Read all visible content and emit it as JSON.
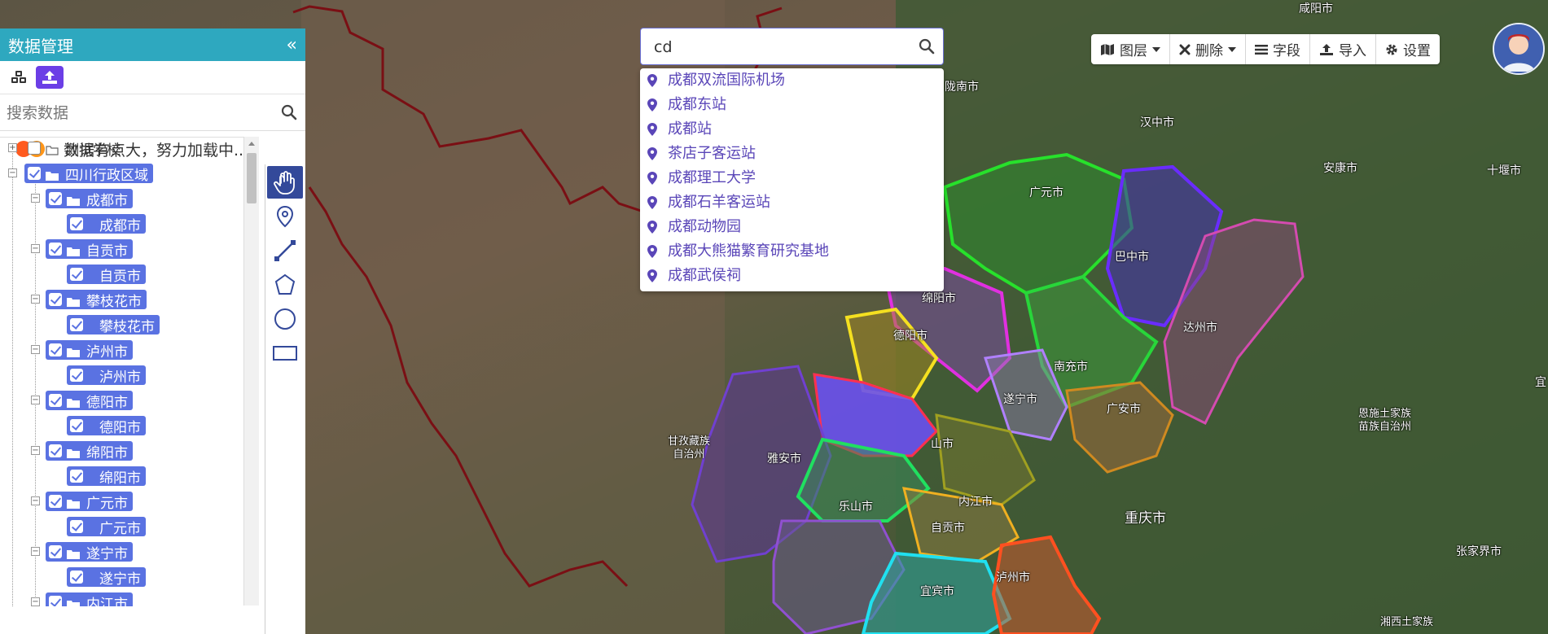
{
  "search": {
    "value": "cd",
    "suggestions": [
      "成都双流国际机场",
      "成都东站",
      "成都站",
      "茶店子客运站",
      "成都理工大学",
      "成都石羊客运站",
      "成都动物园",
      "成都大熊猫繁育研究基地",
      "成都武侯祠"
    ]
  },
  "toolbar": {
    "layers_label": "图层",
    "delete_label": "删除",
    "fields_label": "字段",
    "import_label": "导入",
    "settings_label": "设置"
  },
  "panel": {
    "title": "数据管理",
    "collapse_glyph": "«",
    "search_placeholder": "搜索数据",
    "loading_text": "数据有点大，努力加载中..."
  },
  "tree": {
    "test_school": "测试学校",
    "region": "四川行政区域",
    "cities": [
      "成都市",
      "自贡市",
      "攀枝花市",
      "泸州市",
      "德阳市",
      "绵阳市",
      "广元市",
      "遂宁市",
      "内江市"
    ],
    "leaves": [
      "成都市",
      "自贡市",
      "攀枝花市",
      "泸州市",
      "德阳市",
      "绵阳市",
      "广元市",
      "遂宁市"
    ]
  },
  "map_labels": {
    "xianyang": "咸阳市",
    "longnan": "陇南市",
    "hanzhong": "汉中市",
    "ankang": "安康市",
    "shiyan": "十堰市",
    "guangyuan": "广元市",
    "bazhong": "巴中市",
    "mianyang": "绵阳市",
    "dazhou": "达州市",
    "deyang": "德阳市",
    "nanchong": "南充市",
    "suining": "遂宁市",
    "guangan": "广安市",
    "ganzi": "甘孜藏族\n自治州",
    "yaan": "雅安市",
    "meishan": "山市",
    "leshan": "乐山市",
    "neijiang": "内江市",
    "chongqing": "重庆市",
    "enshi": "恩施土家族\n苗族自治州",
    "zhangjiajie": "张家界市",
    "yibin": "宜宾市",
    "luzhou": "泸州市",
    "xiangxi": "湘西土家族",
    "zigong": "自贡市",
    "yi": "宜"
  },
  "colors": {
    "panel_header": "#2ea8bf",
    "selected_node": "#5a72e2",
    "suggestion_text": "#5a46b8",
    "active_tab": "#6b3ee6",
    "draw_active": "#33499a"
  }
}
